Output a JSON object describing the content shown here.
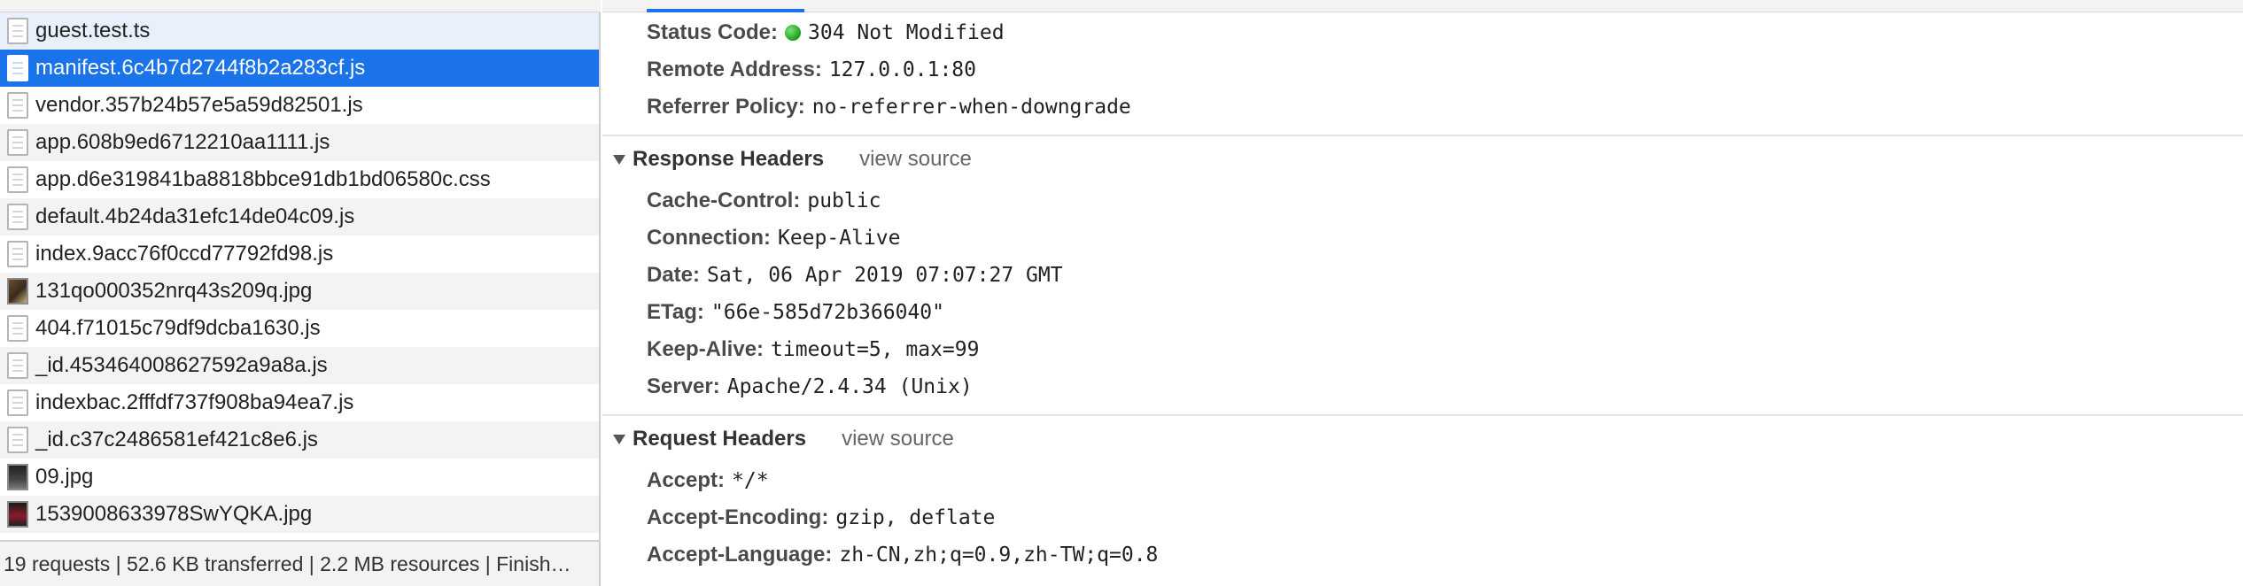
{
  "requests": [
    {
      "name": "guest.test.ts",
      "icon": "document-icon"
    },
    {
      "name": "manifest.6c4b7d2744f8b2a283cf.js",
      "icon": "document-icon"
    },
    {
      "name": "vendor.357b24b57e5a59d82501.js",
      "icon": "document-icon"
    },
    {
      "name": "app.608b9ed6712210aa1111.js",
      "icon": "document-icon"
    },
    {
      "name": "app.d6e319841ba8818bbce91db1bd06580c.css",
      "icon": "document-icon"
    },
    {
      "name": "default.4b24da31efc14de04c09.js",
      "icon": "document-icon"
    },
    {
      "name": "index.9acc76f0ccd77792fd98.js",
      "icon": "document-icon"
    },
    {
      "name": "131qo000352nrq43s209q.jpg",
      "icon": "image-thumbnail-icon"
    },
    {
      "name": "404.f71015c79df9dcba1630.js",
      "icon": "document-icon"
    },
    {
      "name": "_id.453464008627592a9a8a.js",
      "icon": "document-icon"
    },
    {
      "name": "indexbac.2fffdf737f908ba94ea7.js",
      "icon": "document-icon"
    },
    {
      "name": "_id.c37c2486581ef421c8e6.js",
      "icon": "document-icon"
    },
    {
      "name": "09.jpg",
      "icon": "image-thumbnail-icon"
    },
    {
      "name": "1539008633978SwYQKA.jpg",
      "icon": "image-thumbnail-icon"
    }
  ],
  "selected_index": 1,
  "summary": "19 requests | 52.6 KB transferred | 2.2 MB resources | Finish…",
  "general": {
    "status_code_label": "Status Code:",
    "status_code_value": "304 Not Modified",
    "remote_address_label": "Remote Address:",
    "remote_address_value": "127.0.0.1:80",
    "referrer_policy_label": "Referrer Policy:",
    "referrer_policy_value": "no-referrer-when-downgrade"
  },
  "response_headers": {
    "title": "Response Headers",
    "view_source": "view source",
    "items": [
      {
        "k": "Cache-Control:",
        "v": "public"
      },
      {
        "k": "Connection:",
        "v": "Keep-Alive"
      },
      {
        "k": "Date:",
        "v": "Sat, 06 Apr 2019 07:07:27 GMT"
      },
      {
        "k": "ETag:",
        "v": "\"66e-585d72b366040\""
      },
      {
        "k": "Keep-Alive:",
        "v": "timeout=5, max=99"
      },
      {
        "k": "Server:",
        "v": "Apache/2.4.34 (Unix)"
      }
    ]
  },
  "request_headers": {
    "title": "Request Headers",
    "view_source": "view source",
    "items": [
      {
        "k": "Accept:",
        "v": "*/*"
      },
      {
        "k": "Accept-Encoding:",
        "v": "gzip, deflate"
      },
      {
        "k": "Accept-Language:",
        "v": "zh-CN,zh;q=0.9,zh-TW;q=0.8"
      }
    ]
  },
  "colors": {
    "selection": "#1a73e8",
    "status_ok": "#1a9e1a"
  }
}
